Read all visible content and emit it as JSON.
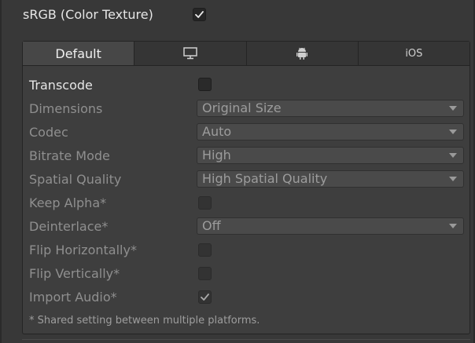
{
  "srgb": {
    "label": "sRGB (Color Texture)",
    "checked": true
  },
  "tabs": [
    {
      "label": "Default",
      "icon": "text",
      "active": true
    },
    {
      "label": "",
      "icon": "monitor-icon",
      "active": false
    },
    {
      "label": "",
      "icon": "android-icon",
      "active": false
    },
    {
      "label": "iOS",
      "icon": "text",
      "active": false
    }
  ],
  "settings": {
    "transcode": {
      "label": "Transcode",
      "checked": false
    },
    "dimensions": {
      "label": "Dimensions",
      "value": "Original Size"
    },
    "codec": {
      "label": "Codec",
      "value": "Auto"
    },
    "bitrate_mode": {
      "label": "Bitrate Mode",
      "value": "High"
    },
    "spatial_quality": {
      "label": "Spatial Quality",
      "value": "High Spatial Quality"
    },
    "keep_alpha": {
      "label": "Keep Alpha*",
      "checked": false
    },
    "deinterlace": {
      "label": "Deinterlace*",
      "value": "Off"
    },
    "flip_horizontally": {
      "label": "Flip Horizontally*",
      "checked": false
    },
    "flip_vertically": {
      "label": "Flip Vertically*",
      "checked": false
    },
    "import_audio": {
      "label": "Import Audio*",
      "checked": true
    }
  },
  "footnote": "* Shared setting between multiple platforms.",
  "colors": {
    "background": "#383838",
    "panel": "#3e3e3e",
    "tab_active": "#474747",
    "text_enabled": "#e6e6e6",
    "text_disabled": "#8f8f8f"
  }
}
